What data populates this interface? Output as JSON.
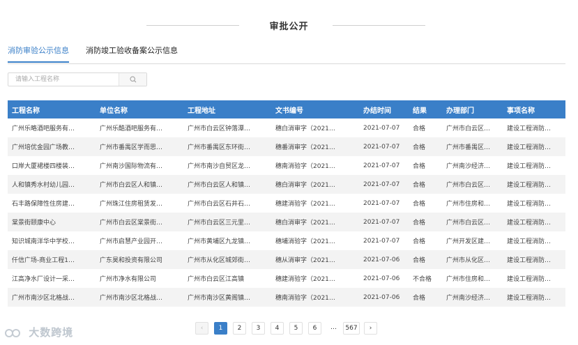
{
  "page_title": "审批公开",
  "tabs": [
    {
      "label": "消防审验公示信息"
    },
    {
      "label": "消防竣工验收备案公示信息"
    }
  ],
  "search": {
    "placeholder": "请输入工程名称",
    "icon": "search-icon"
  },
  "table": {
    "headers": [
      "工程名称",
      "单位名称",
      "工程地址",
      "文书编号",
      "办结时间",
      "结果",
      "办理部门",
      "事项名称"
    ],
    "rows": [
      [
        "广州乐略酒吧服务有…",
        "广州乐酷酒吧服务有…",
        "广州市白云区钟落潭…",
        "穗白消审字（2021…",
        "2021-07-07",
        "合格",
        "广州市白云区…",
        "建设工程消防…"
      ],
      [
        "广州培优金园广场教…",
        "广州市番禺区学而思…",
        "广州市番禺区东环街…",
        "穗番消审字（2021…",
        "2021-07-07",
        "合格",
        "广州市番禺区…",
        "建设工程消防…"
      ],
      [
        "口岸大厦裙楼四楼装…",
        "广州南沙国际物流有…",
        "广州市南沙自贸区龙…",
        "穗南消验字（2021…",
        "2021-07-07",
        "合格",
        "广州南沙经济…",
        "建设工程消防…"
      ],
      [
        "人和镇秀水村幼儿园…",
        "广州市白云区人和镇…",
        "广州市白云区人和镇…",
        "穗白消审字（2021…",
        "2021-07-07",
        "合格",
        "广州市白云区…",
        "建设工程消防…"
      ],
      [
        "石丰路保障性住房建…",
        "广州珠江住房租赁发…",
        "广州市白云区石井石…",
        "穗建消验字（2021…",
        "2021-07-07",
        "合格",
        "广州市住房和…",
        "建设工程消防…"
      ],
      [
        "棠景街颐康中心",
        "广州市白云区棠景街…",
        "广州市白云区三元里…",
        "穗白消审字（2021…",
        "2021-07-07",
        "合格",
        "广州市白云区…",
        "建设工程消防…"
      ],
      [
        "知识城南洋华中学校…",
        "广州市启慧产业园开…",
        "广州市黄埔区九龙镇…",
        "穗埔消验字（2021…",
        "2021-07-07",
        "合格",
        "广州开发区建…",
        "建设工程消防…"
      ],
      [
        "仟信广场-商业工程1…",
        "广东昊和投资有限公司",
        "广州市从化区城郊街…",
        "穗从消审字（2021…",
        "2021-07-06",
        "合格",
        "广州市从化区…",
        "建设工程消防…"
      ],
      [
        "江高净水厂设计一采…",
        "广州市净水有限公司",
        "广州市白云区江高镇",
        "穗建消验字（2021…",
        "2021-07-06",
        "不合格",
        "广州市住房和…",
        "建设工程消防…"
      ],
      [
        "广州市南沙区北格战…",
        "广州市南沙区北格战…",
        "广州市南沙区黄阁镇…",
        "穗南消验字（2021…",
        "2021-07-06",
        "合格",
        "广州南沙经济…",
        "建设工程消防…"
      ]
    ]
  },
  "pagination": {
    "prev": "‹",
    "pages": [
      "1",
      "2",
      "3",
      "4",
      "5",
      "6"
    ],
    "ellipsis": "…",
    "last": "567",
    "next": "›",
    "current": "1"
  },
  "watermark": "大数跨境",
  "colors": {
    "accent": "#3a7fc8",
    "header_bg": "#3a7fc8",
    "stripe": "#f3f3f3"
  }
}
